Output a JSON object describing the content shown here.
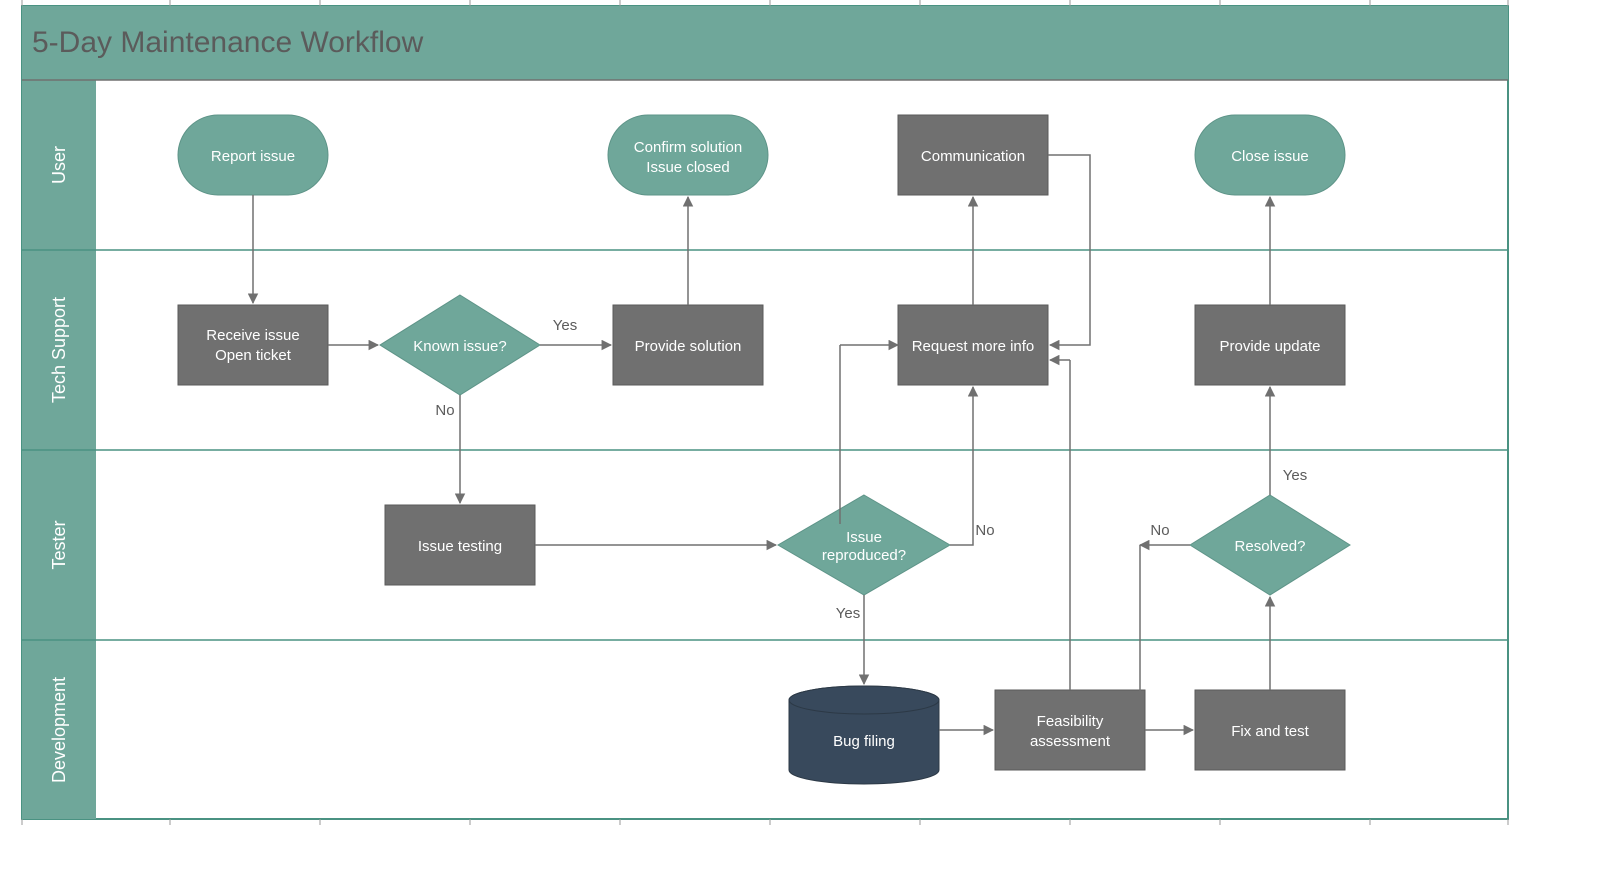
{
  "title": "5-Day Maintenance Workflow",
  "lanes": [
    {
      "id": "user",
      "label": "User"
    },
    {
      "id": "support",
      "label": "Tech Support"
    },
    {
      "id": "tester",
      "label": "Tester"
    },
    {
      "id": "dev",
      "label": "Development"
    }
  ],
  "nodes": {
    "report_issue": {
      "label": "Report issue"
    },
    "confirm_solution": {
      "label1": "Confirm solution",
      "label2": "Issue closed"
    },
    "communication": {
      "label": "Communication"
    },
    "close_issue": {
      "label": "Close issue"
    },
    "receive_issue": {
      "label1": "Receive issue",
      "label2": "Open ticket"
    },
    "known_issue": {
      "label": "Known issue?"
    },
    "provide_solution": {
      "label": "Provide solution"
    },
    "request_more_info": {
      "label": "Request more info"
    },
    "provide_update": {
      "label": "Provide update"
    },
    "issue_testing": {
      "label": "Issue testing"
    },
    "issue_reproduced": {
      "label1": "Issue",
      "label2": "reproduced?"
    },
    "resolved": {
      "label": "Resolved?"
    },
    "bug_filing": {
      "label": "Bug filing"
    },
    "feasibility": {
      "label1": "Feasibility",
      "label2": "assessment"
    },
    "fix_and_test": {
      "label": "Fix and test"
    }
  },
  "edge_labels": {
    "known_yes": "Yes",
    "known_no": "No",
    "repro_yes": "Yes",
    "repro_no": "No",
    "resolved_yes": "Yes",
    "resolved_no": "No"
  },
  "colors": {
    "teal": "#6fa79a",
    "grey": "#707070",
    "dark": "#38495c",
    "border": "#4a9282"
  }
}
